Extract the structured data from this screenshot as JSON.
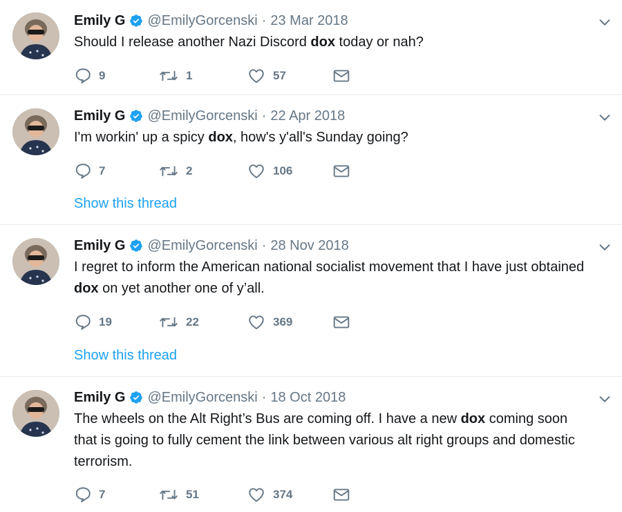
{
  "tweets": [
    {
      "name": "Emily G",
      "handle": "@EmilyGorcenski",
      "sep": "·",
      "date": "23 Mar 2018",
      "text_before": "Should I release another Nazi Discord ",
      "text_bold": "dox",
      "text_after": " today or nah?",
      "replies": "9",
      "retweets": "1",
      "likes": "57",
      "thread": ""
    },
    {
      "name": "Emily G",
      "handle": "@EmilyGorcenski",
      "sep": "·",
      "date": "22 Apr 2018",
      "text_before": "I'm workin' up a spicy ",
      "text_bold": "dox",
      "text_after": ", how's y'all's Sunday going?",
      "replies": "7",
      "retweets": "2",
      "likes": "106",
      "thread": "Show this thread"
    },
    {
      "name": "Emily G",
      "handle": "@EmilyGorcenski",
      "sep": "·",
      "date": "28 Nov 2018",
      "text_before": "I regret to inform the American national socialist movement that I have just obtained ",
      "text_bold": "dox",
      "text_after": " on yet another one of y’all.",
      "replies": "19",
      "retweets": "22",
      "likes": "369",
      "thread": "Show this thread"
    },
    {
      "name": "Emily G",
      "handle": "@EmilyGorcenski",
      "sep": "·",
      "date": "18 Oct 2018",
      "text_before": "The wheels on the Alt Right’s Bus are coming off. I have a new ",
      "text_bold": "dox",
      "text_after": " coming soon that is going to fully cement the link between various alt right groups and domestic terrorism.",
      "replies": "7",
      "retweets": "51",
      "likes": "374",
      "thread": ""
    }
  ],
  "icons": {
    "reply": "reply-icon",
    "retweet": "retweet-icon",
    "like": "heart-icon",
    "message": "envelope-icon",
    "verified": "verified-badge-icon",
    "caret": "chevron-down-icon"
  },
  "colors": {
    "text": "#14171a",
    "muted": "#657786",
    "link": "#1da1f2",
    "verified": "#1da1f2",
    "divider": "#e6ecf0"
  }
}
